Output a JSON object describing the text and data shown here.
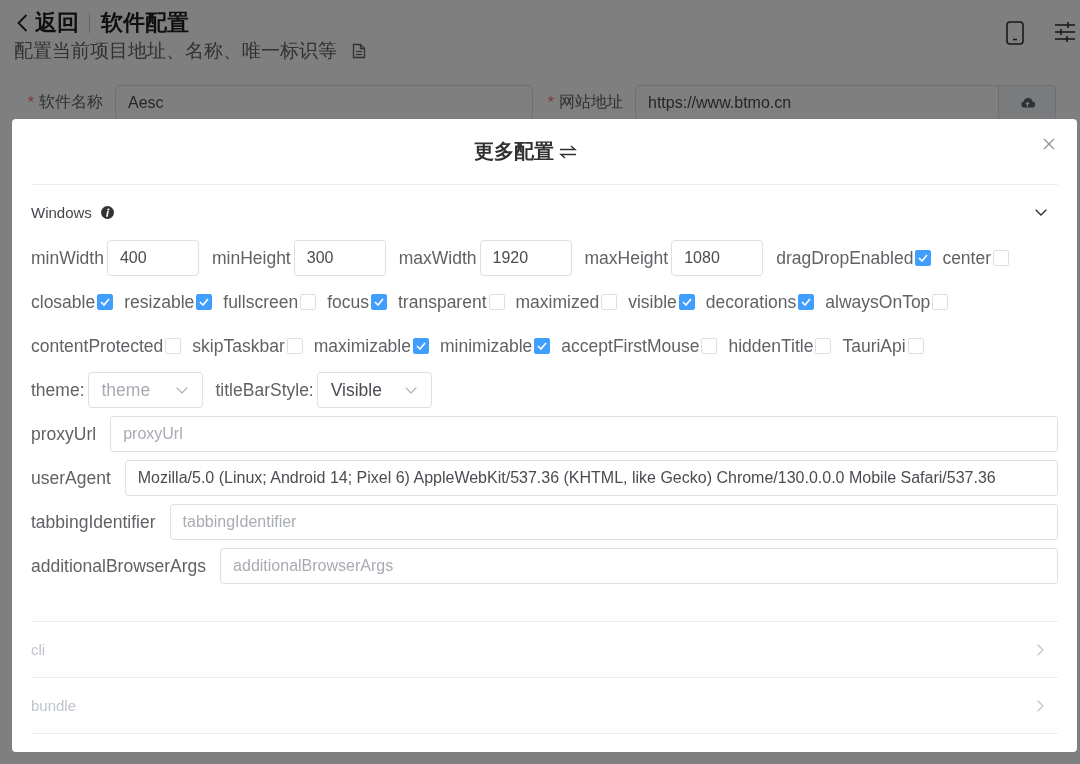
{
  "header": {
    "back_label": "返回",
    "title": "软件配置",
    "subtitle": "配置当前项目地址、名称、唯一标识等"
  },
  "form": {
    "fields": [
      {
        "kind": "text",
        "required_mark": "*",
        "label": "软件名称",
        "value": "Aesc"
      },
      {
        "kind": "upload",
        "required_mark": "*",
        "label": "网站地址",
        "value": "https://www.btmo.cn"
      }
    ]
  },
  "dialog": {
    "title": "更多配置",
    "sections": [
      {
        "title": "Windows",
        "info": true,
        "expanded": true,
        "disabled": false,
        "rows": [
          {
            "items": [
              {
                "kind": "number",
                "label": "minWidth",
                "value": "400"
              },
              {
                "kind": "number",
                "label": "minHeight",
                "value": "300"
              },
              {
                "kind": "number",
                "label": "maxWidth",
                "value": "1920"
              },
              {
                "kind": "number",
                "label": "maxHeight",
                "value": "1080"
              },
              {
                "kind": "checkbox",
                "label": "dragDropEnabled",
                "checked": true
              },
              {
                "kind": "checkbox",
                "label": "center",
                "checked": false
              }
            ]
          },
          {
            "items": [
              {
                "kind": "checkbox",
                "label": "closable",
                "checked": true
              },
              {
                "kind": "checkbox",
                "label": "resizable",
                "checked": true
              },
              {
                "kind": "checkbox",
                "label": "fullscreen",
                "checked": false
              },
              {
                "kind": "checkbox",
                "label": "focus",
                "checked": true
              },
              {
                "kind": "checkbox",
                "label": "transparent",
                "checked": false
              },
              {
                "kind": "checkbox",
                "label": "maximized",
                "checked": false
              },
              {
                "kind": "checkbox",
                "label": "visible",
                "checked": true
              },
              {
                "kind": "checkbox",
                "label": "decorations",
                "checked": true
              },
              {
                "kind": "checkbox",
                "label": "alwaysOnTop",
                "checked": false
              }
            ]
          },
          {
            "items": [
              {
                "kind": "checkbox",
                "label": "contentProtected",
                "checked": false
              },
              {
                "kind": "checkbox",
                "label": "skipTaskbar",
                "checked": false
              },
              {
                "kind": "checkbox",
                "label": "maximizable",
                "checked": true
              },
              {
                "kind": "checkbox",
                "label": "minimizable",
                "checked": true
              },
              {
                "kind": "checkbox",
                "label": "acceptFirstMouse",
                "checked": false
              },
              {
                "kind": "checkbox",
                "label": "hiddenTitle",
                "checked": false
              },
              {
                "kind": "checkbox",
                "label": "TauriApi",
                "checked": false
              }
            ]
          },
          {
            "items": [
              {
                "kind": "select",
                "label": "theme:",
                "placeholder": "theme"
              },
              {
                "kind": "select",
                "label": "titleBarStyle:",
                "value": "Visible"
              }
            ]
          },
          {
            "items": [
              {
                "kind": "text",
                "label": "proxyUrl",
                "placeholder": "proxyUrl"
              }
            ]
          },
          {
            "items": [
              {
                "kind": "text",
                "label": "userAgent",
                "value": "Mozilla/5.0 (Linux; Android 14; Pixel 6) AppleWebKit/537.36 (KHTML, like Gecko) Chrome/130.0.0.0 Mobile Safari/537.36"
              }
            ]
          },
          {
            "items": [
              {
                "kind": "text",
                "label": "tabbingIdentifier",
                "placeholder": "tabbingIdentifier"
              }
            ]
          },
          {
            "items": [
              {
                "kind": "text",
                "label": "additionalBrowserArgs",
                "placeholder": "additionalBrowserArgs"
              }
            ]
          }
        ]
      },
      {
        "title": "cli",
        "info": false,
        "expanded": false,
        "disabled": true
      },
      {
        "title": "bundle",
        "info": false,
        "expanded": false,
        "disabled": true
      }
    ]
  }
}
